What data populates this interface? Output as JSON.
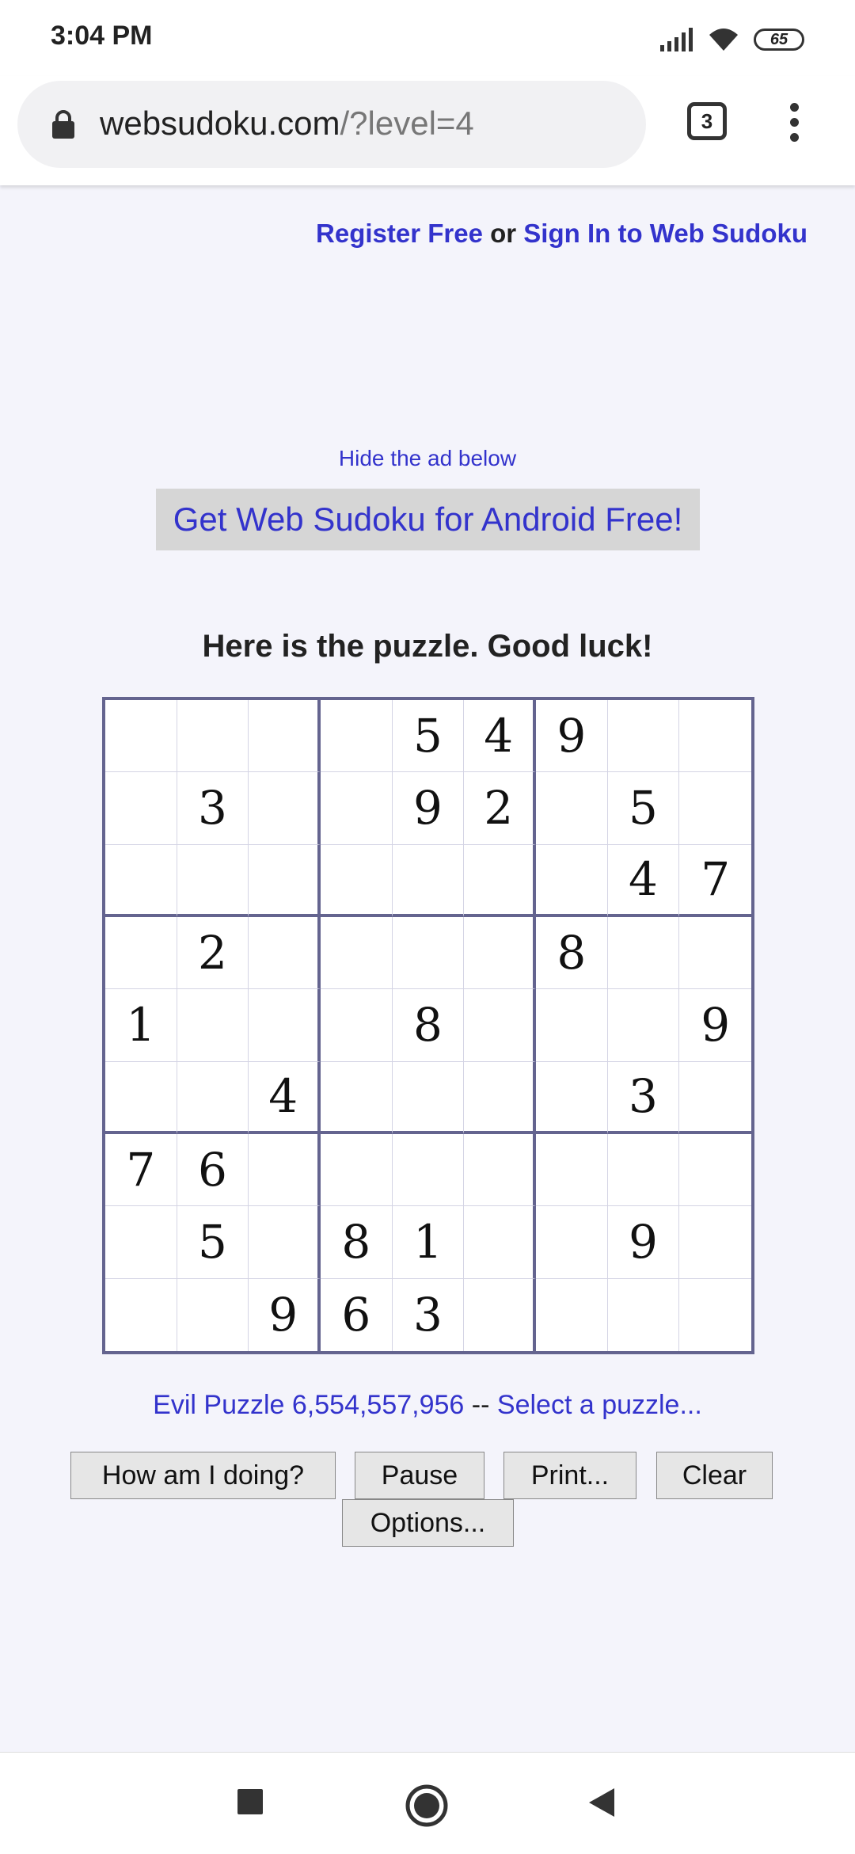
{
  "status_bar": {
    "time": "3:04 PM",
    "battery": "65"
  },
  "browser": {
    "url_domain": "websudoku.com",
    "url_path": "/?level=4",
    "tab_count": "3"
  },
  "header": {
    "register_label": "Register Free",
    "or_text": " or ",
    "signin_label": "Sign In to Web Sudoku"
  },
  "ad": {
    "hide_label": "Hide the ad below",
    "android_label": "Get Web Sudoku for Android Free!"
  },
  "puzzle": {
    "heading": "Here is the puzzle. Good luck!",
    "grid": [
      [
        "",
        "",
        "",
        "",
        "5",
        "4",
        "9",
        "",
        ""
      ],
      [
        "",
        "3",
        "",
        "",
        "9",
        "2",
        "",
        "5",
        ""
      ],
      [
        "",
        "",
        "",
        "",
        "",
        "",
        "",
        "4",
        "7"
      ],
      [
        "",
        "2",
        "",
        "",
        "",
        "",
        "8",
        "",
        ""
      ],
      [
        "1",
        "",
        "",
        "",
        "8",
        "",
        "",
        "",
        "9"
      ],
      [
        "",
        "",
        "4",
        "",
        "",
        "",
        "",
        "3",
        ""
      ],
      [
        "7",
        "6",
        "",
        "",
        "",
        "",
        "",
        "",
        ""
      ],
      [
        "",
        "5",
        "",
        "8",
        "1",
        "",
        "",
        "9",
        ""
      ],
      [
        "",
        "",
        "9",
        "6",
        "3",
        "",
        "",
        "",
        ""
      ]
    ],
    "info_label": "Evil Puzzle 6,554,557,956",
    "separator": " -- ",
    "select_label": "Select a puzzle..."
  },
  "buttons": {
    "how_label": "How am I doing?",
    "pause_label": "Pause",
    "print_label": "Print...",
    "clear_label": "Clear",
    "options_label": "Options..."
  },
  "colors": {
    "link": "#3333cc",
    "grid_border": "#64648f",
    "background": "#f4f4fb"
  }
}
